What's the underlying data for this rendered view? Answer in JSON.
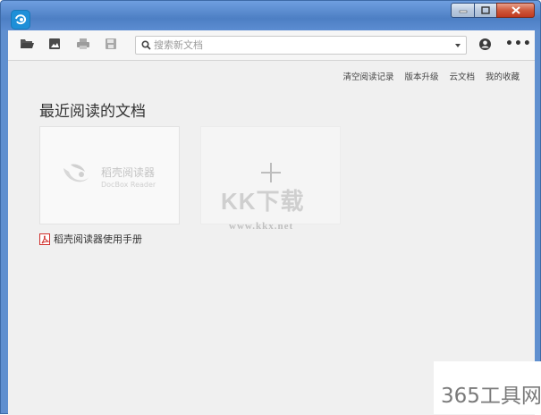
{
  "window": {
    "minimize_label": "",
    "maximize_label": "",
    "close_label": ""
  },
  "toolbar": {
    "search_placeholder": "搜索新文档",
    "icons": [
      "folder-open-icon",
      "image-icon",
      "print-icon",
      "save-icon",
      "user-icon",
      "more-icon"
    ]
  },
  "links": {
    "clear_history": "清空阅读记录",
    "upgrade": "版本升级",
    "cloud_docs": "云文档",
    "favorites": "我的收藏"
  },
  "main": {
    "heading": "最近阅读的文档",
    "recent_doc": {
      "thumb_name": "稻壳阅读器",
      "thumb_sub": "DocBox Reader",
      "title": "稻壳阅读器使用手册"
    }
  },
  "watermarks": {
    "center_text": "KK下载",
    "center_url": "www.kkx.net",
    "corner_text": "365工具网"
  },
  "colors": {
    "title_bar": "#5c8dd2",
    "client_bg": "#f0f0f0",
    "app_icon": "#1e8fd8",
    "pdf_red": "#d0312d",
    "close_button": "#c0391f"
  }
}
